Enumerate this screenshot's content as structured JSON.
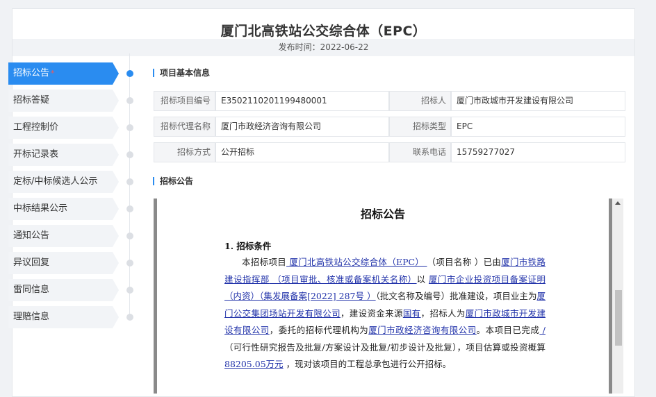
{
  "page": {
    "title": "厦门北高铁站公交综合体（EPC）",
    "publish_time": "发布时间：2022-06-22"
  },
  "sidebar": {
    "items": [
      {
        "label": "招标公告",
        "active": true,
        "required_mark": "*"
      },
      {
        "label": "招标答疑"
      },
      {
        "label": "工程控制价"
      },
      {
        "label": "开标记录表"
      },
      {
        "label": "定标/中标候选人公示"
      },
      {
        "label": "中标结果公示"
      },
      {
        "label": "通知公告"
      },
      {
        "label": "异议回复"
      },
      {
        "label": "雷同信息"
      },
      {
        "label": "理赔信息"
      }
    ]
  },
  "basic_info": {
    "heading": "项目基本信息",
    "rows": [
      [
        {
          "label": "招标项目编号",
          "value": "E3502110201199480001"
        },
        {
          "label": "招标人",
          "value": "厦门市政城市开发建设有限公司"
        }
      ],
      [
        {
          "label": "招标代理名称",
          "value": "厦门市政经济咨询有限公司"
        },
        {
          "label": "招标类型",
          "value": "EPC"
        }
      ],
      [
        {
          "label": "招标方式",
          "value": "公开招标"
        },
        {
          "label": "联系电话",
          "value": "15759277027"
        }
      ]
    ]
  },
  "notice": {
    "heading": "招标公告",
    "doc_title": "招标公告",
    "section_title": "1. 招标条件",
    "p": {
      "t1": "本招标项目",
      "u1": "       厦门北高铁站公交综合体（EPC）     ",
      "t2": "（项目名称  ）已由",
      "u2": "厦门市铁路建设指挥部",
      "t3": "     （项目审批、核准或备案机关名称）",
      "t4": "以  ",
      "u3": "厦门市企业投资项目备案证明（内资）（集发展备案[2022] 287号 ）",
      "t5": "（批文名称及编号）批准建设，项目业主为",
      "u4": "厦门公交集团场站开发有限公司",
      "t6": "，建设资金来源",
      "u5": "国有",
      "t7": "，招标人为",
      "u6": "厦门市政城市开发建设有限公司",
      "t8": "，委托的招标代理机构为",
      "u7": "厦门市政经济咨询有限公司",
      "t9": "。本项目已完成",
      "u8": "  /  ",
      "t10": "（可行性研究报告及批复/方案设计及批复/初步设计及批复）",
      "t11": "，项目估算或投资概算",
      "u9": "88205.05万元",
      "t12": " ，现对该项目的工程总承包进行公开招标。"
    }
  },
  "colors": {
    "accent": "#2a8cf0"
  }
}
